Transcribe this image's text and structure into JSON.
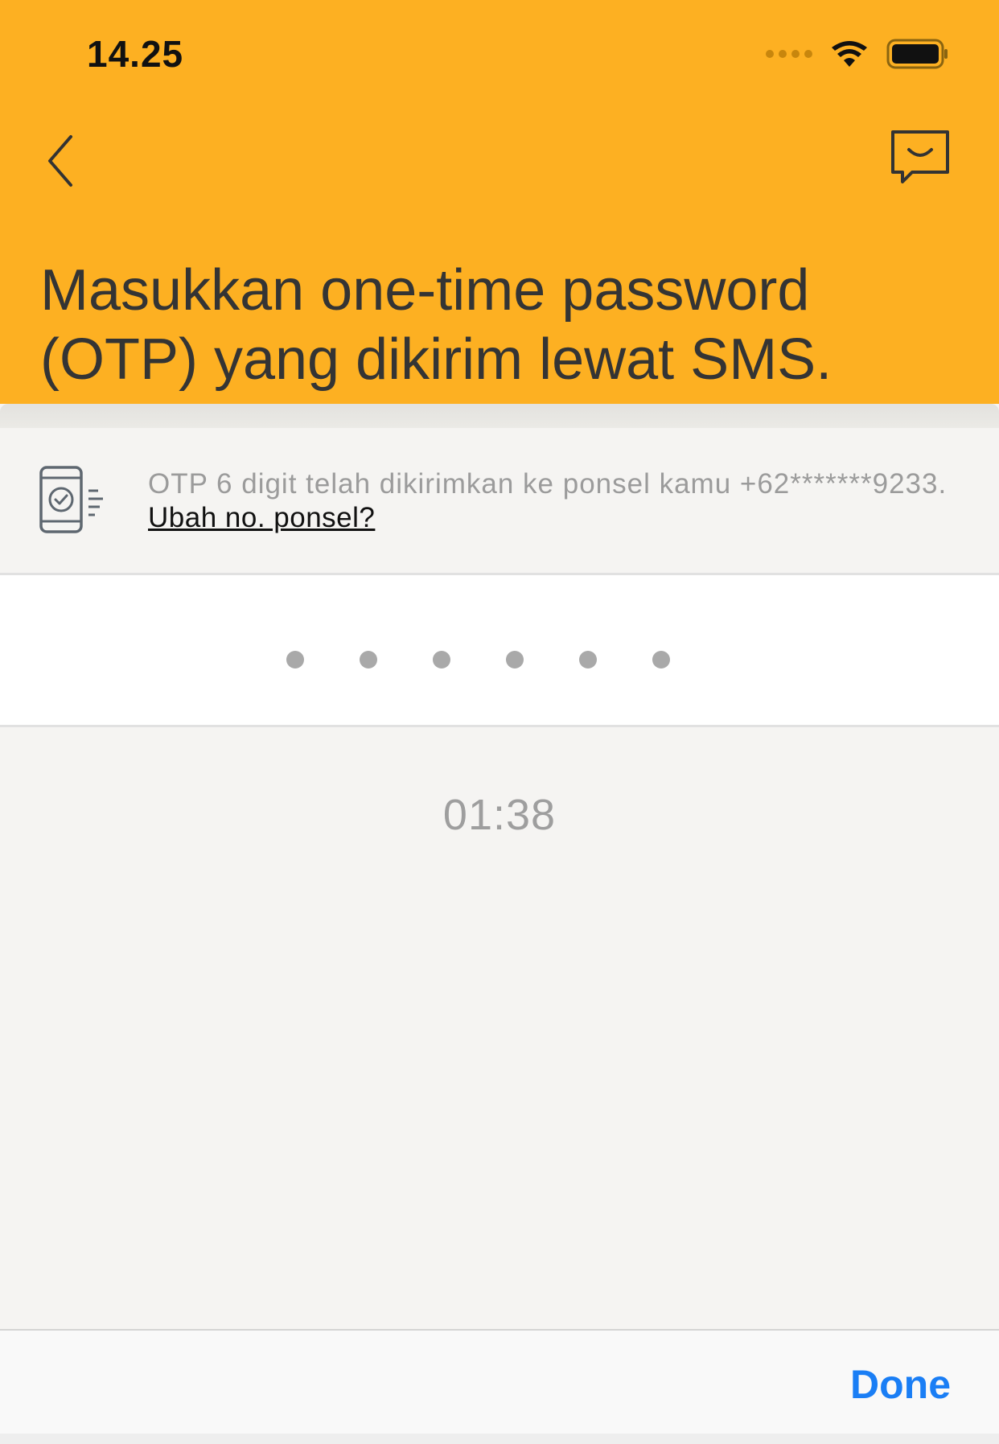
{
  "status_bar": {
    "time": "14.25",
    "icons": [
      "signal-dots-icon",
      "wifi-icon",
      "battery-icon"
    ]
  },
  "nav": {
    "back_icon": "chevron-left-icon",
    "chat_icon": "chat-bubble-icon"
  },
  "header": {
    "title": "Masukkan one-time password (OTP) yang dikirim lewat SMS."
  },
  "info": {
    "icon": "phone-check-icon",
    "message": "OTP 6 digit telah dikirimkan ke ponsel kamu +62*******9233.",
    "change_link": "Ubah no. ponsel?"
  },
  "otp": {
    "digits": 6,
    "value": ""
  },
  "timer": {
    "text": "01:38"
  },
  "keyboard_toolbar": {
    "done_label": "Done"
  },
  "colors": {
    "header_bg": "#fdb022",
    "accent_blue": "#1a7ef5",
    "background": "#f5f4f2"
  }
}
